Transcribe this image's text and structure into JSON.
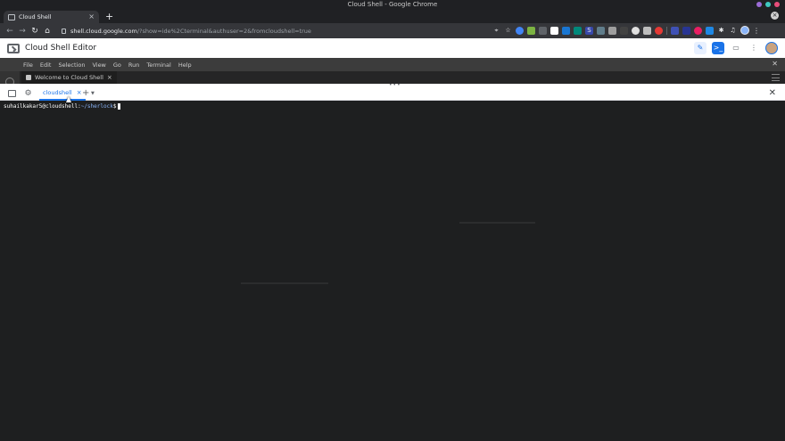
{
  "window": {
    "title": "Cloud Shell - Google Chrome"
  },
  "browser": {
    "tab_title": "Cloud Shell",
    "url_host": "shell.cloud.google.com",
    "url_rest": "/?show=ide%2Cterminal&authuser=2&fromcloudshell=true"
  },
  "app": {
    "title": "Cloud Shell Editor"
  },
  "menu": {
    "items": [
      "File",
      "Edit",
      "Selection",
      "View",
      "Go",
      "Run",
      "Terminal",
      "Help"
    ]
  },
  "editor": {
    "tab_label": "Welcome to Cloud Shell"
  },
  "terminal": {
    "tab_label": "cloudshell",
    "prompt_user": "suhailkakar5@cloudshell:",
    "prompt_path": "~/sherlock",
    "prompt_sign": "$"
  },
  "colors": {
    "accent": "#1a73e8",
    "terminal_bg": "#1e1f20",
    "menubar_bg": "#3c3c3c"
  }
}
